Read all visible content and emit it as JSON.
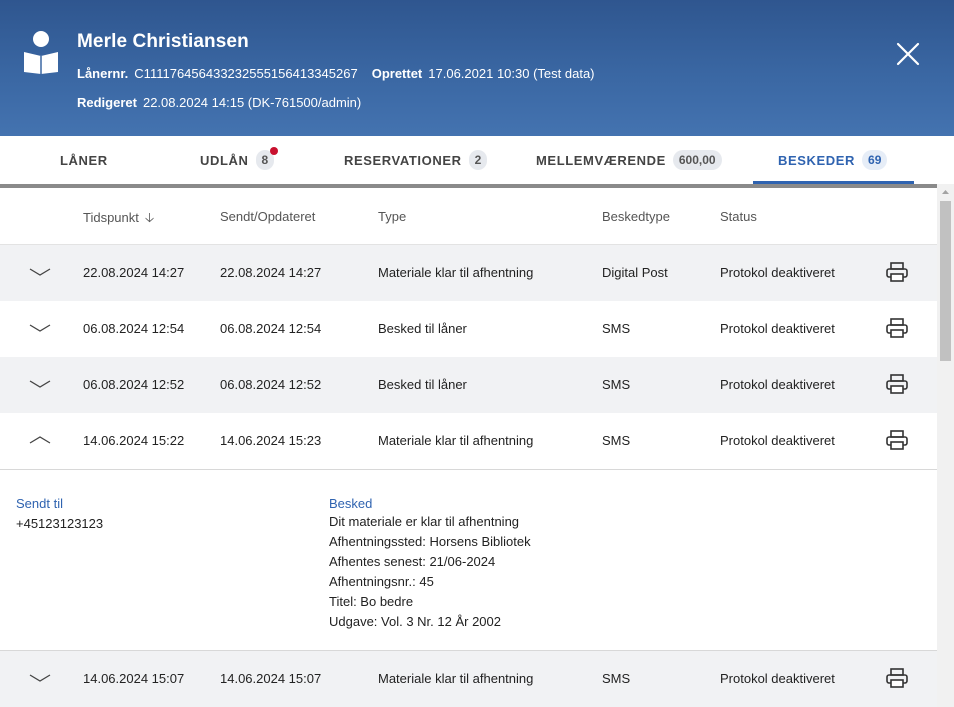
{
  "header": {
    "name": "Merle Christiansen",
    "lanernr_label": "Lånernr.",
    "lanernr_value": "C111176456433232555156413345267",
    "oprettet_label": "Oprettet",
    "oprettet_value": "17.06.2021 10:30 (Test data)",
    "redigeret_label": "Redigeret",
    "redigeret_value": "22.08.2024 14:15 (DK-761500/admin)"
  },
  "tabs": [
    {
      "label": "LÅNER",
      "badge": ""
    },
    {
      "label": "UDLÅN",
      "badge": "8"
    },
    {
      "label": "RESERVATIONER",
      "badge": "2"
    },
    {
      "label": "MELLEMVÆRENDE",
      "badge": "600,00"
    },
    {
      "label": "BESKEDER",
      "badge": "69"
    }
  ],
  "table": {
    "columns": [
      "Tidspunkt",
      "Sendt/Opdateret",
      "Type",
      "Beskedtype",
      "Status"
    ],
    "rows": [
      {
        "tidspunkt": "22.08.2024 14:27",
        "sendt": "22.08.2024 14:27",
        "type": "Materiale klar til afhentning",
        "beskedtype": "Digital Post",
        "status": "Protokol deaktiveret"
      },
      {
        "tidspunkt": "06.08.2024 12:54",
        "sendt": "06.08.2024 12:54",
        "type": "Besked til låner",
        "beskedtype": "SMS",
        "status": "Protokol deaktiveret"
      },
      {
        "tidspunkt": "06.08.2024 12:52",
        "sendt": "06.08.2024 12:52",
        "type": "Besked til låner",
        "beskedtype": "SMS",
        "status": "Protokol deaktiveret"
      },
      {
        "tidspunkt": "14.06.2024 15:22",
        "sendt": "14.06.2024 15:23",
        "type": "Materiale klar til afhentning",
        "beskedtype": "SMS",
        "status": "Protokol deaktiveret"
      },
      {
        "tidspunkt": "14.06.2024 15:07",
        "sendt": "14.06.2024 15:07",
        "type": "Materiale klar til afhentning",
        "beskedtype": "SMS",
        "status": "Protokol deaktiveret"
      }
    ]
  },
  "detail": {
    "sendt_til_label": "Sendt til",
    "sendt_til_value": "+45123123123",
    "besked_label": "Besked",
    "besked_lines": [
      "Dit materiale er klar til afhentning",
      "Afhentningssted: Horsens Bibliotek",
      "Afhentes senest: 21/06-2024",
      "Afhentningsnr.: 45",
      "Titel: Bo bedre",
      "Udgave: Vol. 3 Nr. 12 År 2002"
    ]
  },
  "icons": {
    "avatar": "reader-icon",
    "close": "close-icon",
    "sort": "arrow-down-icon",
    "expand": "chevron-down-icon",
    "collapse": "chevron-up-icon",
    "print": "printer-icon"
  },
  "colors": {
    "header_bg": "#3a67a3",
    "accent": "#2f63b0",
    "notification_dot": "#c8102e",
    "row_shade": "#f1f2f4"
  }
}
